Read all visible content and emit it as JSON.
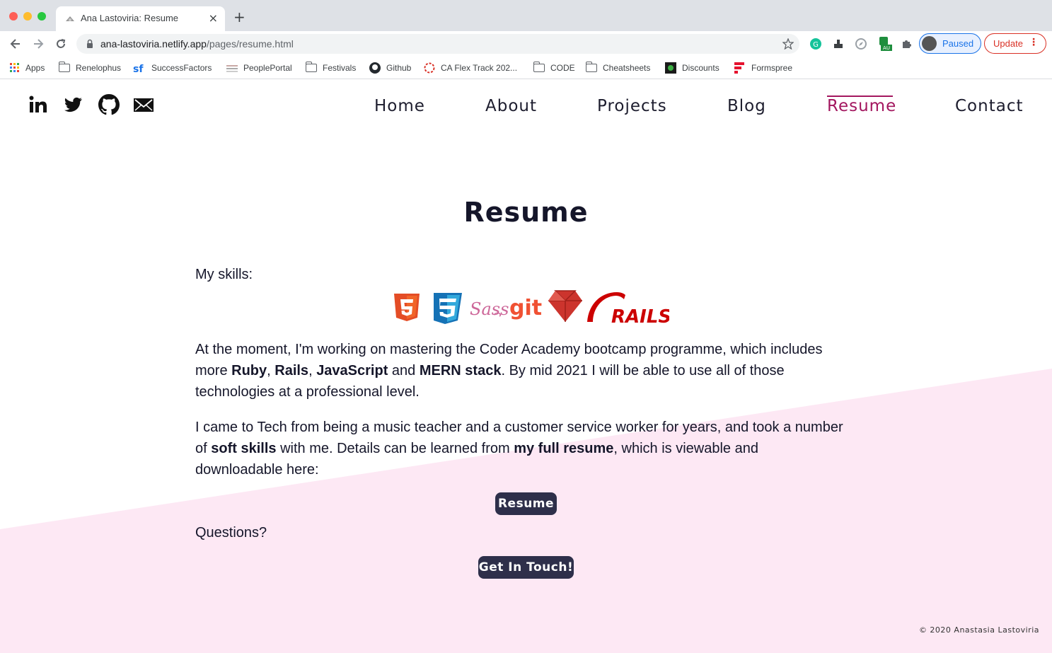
{
  "browser": {
    "tab_title": "Ana Lastoviria: Resume",
    "tab_close": "×",
    "new_tab": "+",
    "url_host": "ana-lastoviria.netlify.app",
    "url_path": "/pages/resume.html",
    "profile_label": "Paused",
    "update_label": "Update",
    "bookmarks": [
      {
        "label": "Apps",
        "icon": "apps-grid-icon"
      },
      {
        "label": "Renelophus",
        "icon": "folder-icon"
      },
      {
        "label": "SuccessFactors",
        "icon": "successfactors-icon"
      },
      {
        "label": "PeoplePortal",
        "icon": "peopleportal-icon"
      },
      {
        "label": "Festivals",
        "icon": "folder-icon"
      },
      {
        "label": "Github",
        "icon": "github-icon"
      },
      {
        "label": "CA Flex Track 202...",
        "icon": "ca-icon"
      },
      {
        "label": "CODE",
        "icon": "folder-icon"
      },
      {
        "label": "Cheatsheets",
        "icon": "folder-icon"
      },
      {
        "label": "Discounts",
        "icon": "discounts-icon"
      },
      {
        "label": "Formspree",
        "icon": "formspree-icon"
      }
    ]
  },
  "site": {
    "nav": [
      {
        "label": "Home",
        "active": false
      },
      {
        "label": "About",
        "active": false
      },
      {
        "label": "Projects",
        "active": false
      },
      {
        "label": "Blog",
        "active": false
      },
      {
        "label": "Resume",
        "active": true
      },
      {
        "label": "Contact",
        "active": false
      }
    ],
    "social": [
      "linkedin-icon",
      "twitter-icon",
      "github-icon",
      "email-icon"
    ],
    "accent_color": "#a3175f",
    "pink_color": "#fde8f4"
  },
  "main": {
    "title": "Resume",
    "skills_label": "My skills:",
    "skills": [
      "html5-logo",
      "css3-logo",
      "sass-logo",
      "git-logo",
      "ruby-logo",
      "rails-logo"
    ],
    "sass_text": "Sass",
    "git_text": "git",
    "rails_text": "RAILS",
    "para1_a": "At the moment, I'm working on mastering the Coder Academy bootcamp programme, which includes more ",
    "para1_ruby": "Ruby",
    "para1_comma1": ", ",
    "para1_rails": "Rails",
    "para1_comma2": ", ",
    "para1_js": "JavaScript",
    "para1_and": " and ",
    "para1_mern": "MERN stack",
    "para1_b": ". By mid 2021 I will be able to use all of those technologies at a professional level.",
    "para2_a": "I came to Tech from being a music teacher and a customer service worker for years, and took a number of ",
    "para2_soft": "soft skills",
    "para2_b": " with me. Details can be learned from ",
    "para2_resume": "my full resume",
    "para2_c": ", which is viewable and downloadable here:",
    "resume_button": "Resume",
    "questions": "Questions?",
    "contact_button": "Get In Touch!"
  },
  "footer": {
    "copyright": "© 2020 Anastasia Lastoviria"
  }
}
